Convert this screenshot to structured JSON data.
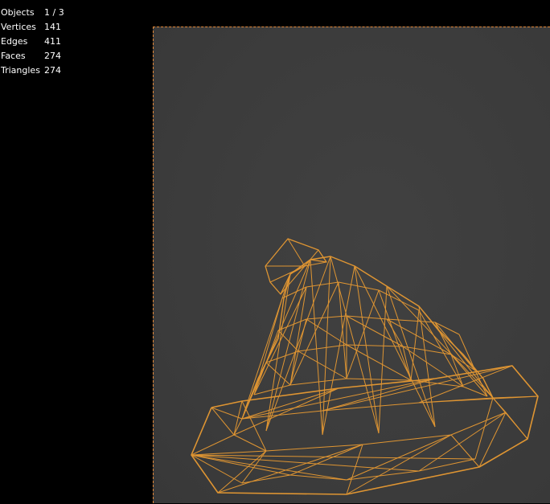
{
  "stats": [
    {
      "label": "Objects",
      "value": "1 / 3"
    },
    {
      "label": "Vertices",
      "value": "141"
    },
    {
      "label": "Edges",
      "value": "411"
    },
    {
      "label": "Faces",
      "value": "274"
    },
    {
      "label": "Triangles",
      "value": "274"
    }
  ],
  "colors": {
    "background": "#000000",
    "viewport": "#3c3c3c",
    "selection_outline": "#e58a3a",
    "wireframe": "#e89a32"
  },
  "viewport": {
    "object": "wizard-hat-mesh",
    "display_mode": "wireframe",
    "selected": true
  }
}
